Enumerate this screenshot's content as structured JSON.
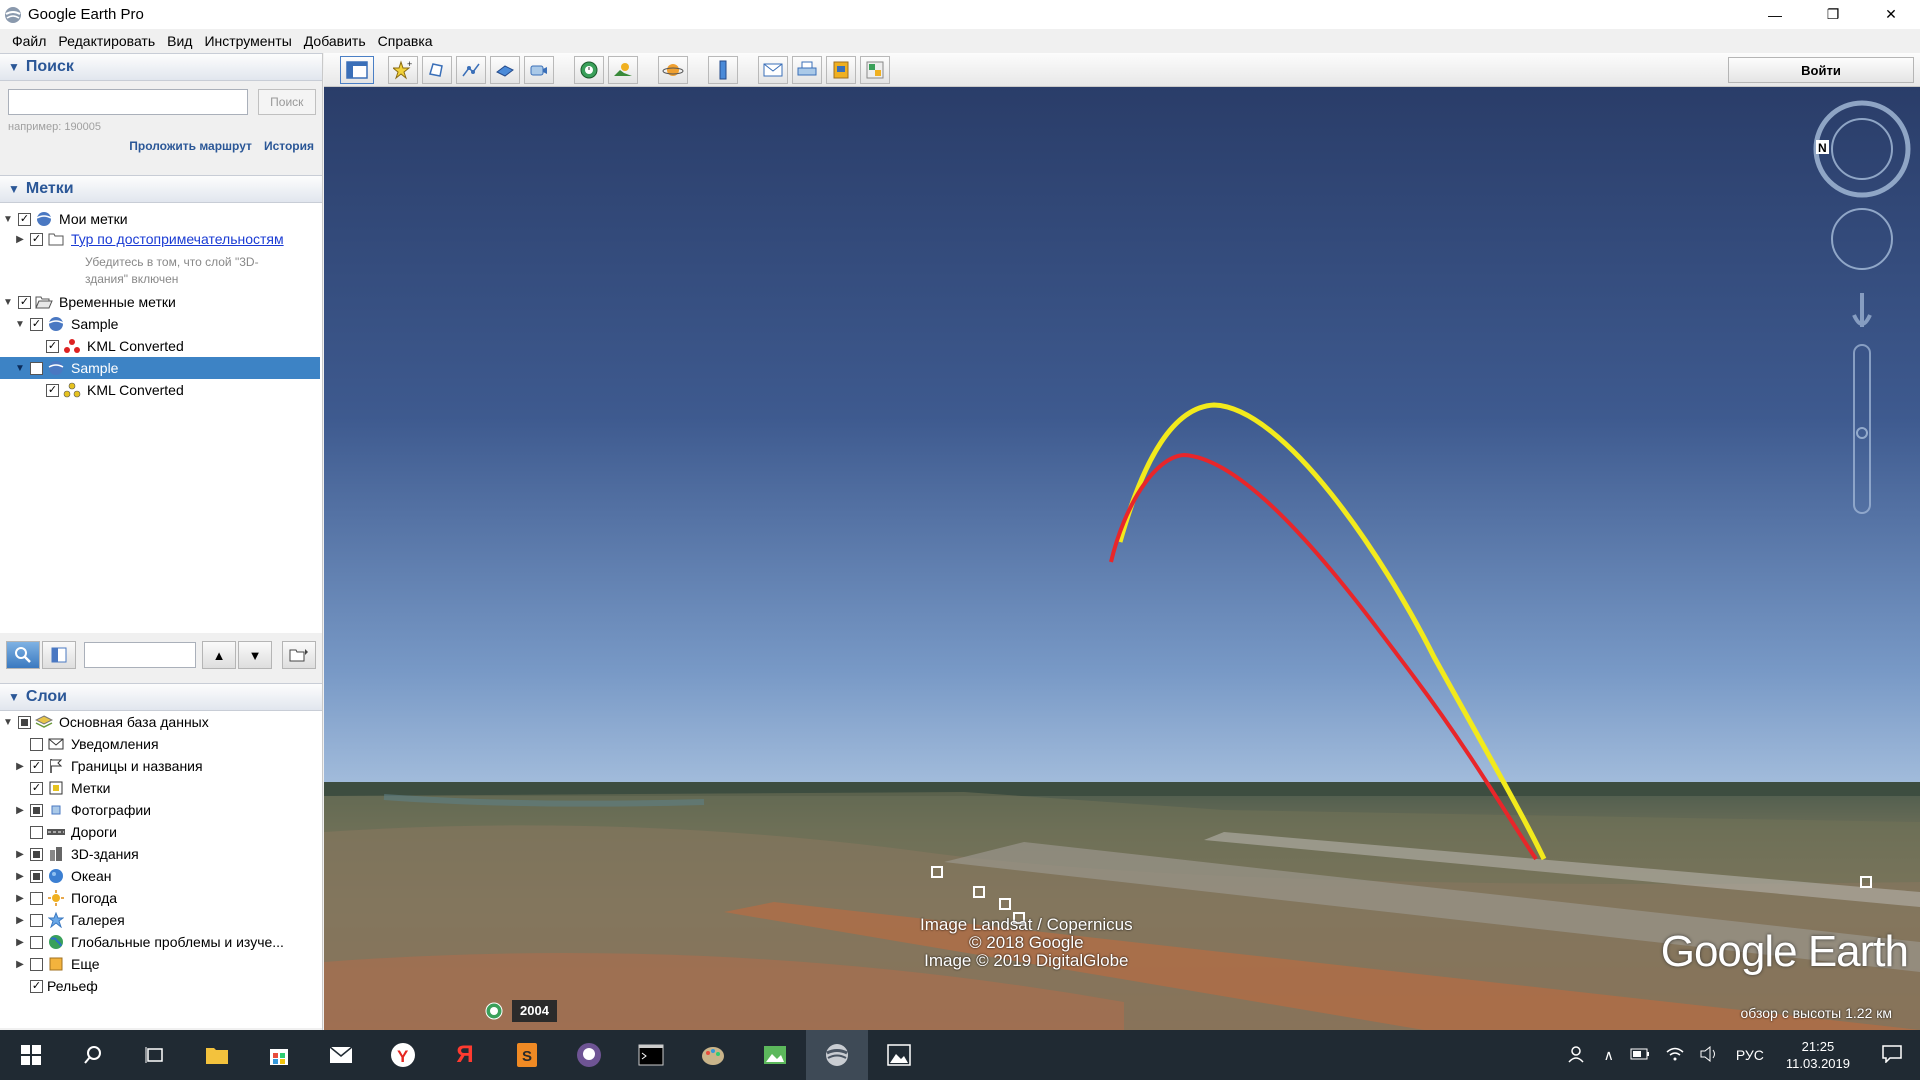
{
  "window": {
    "title": "Google Earth Pro",
    "minimize": "—",
    "maximize": "❐",
    "close": "✕"
  },
  "menu": [
    {
      "label": "Файл"
    },
    {
      "label": "Редактировать"
    },
    {
      "label": "Вид"
    },
    {
      "label": "Инструменты"
    },
    {
      "label": "Добавить"
    },
    {
      "label": "Справка"
    }
  ],
  "search": {
    "header": "Поиск",
    "input_value": "",
    "button": "Поиск",
    "hint": "например: 190005",
    "route_link": "Проложить маршрут",
    "history_link": "История"
  },
  "places": {
    "header": "Метки",
    "my_places": "Мои метки",
    "tour": "Тур по достопримечательностям",
    "tour_note_1": "Убедитесь в том, что слой \"3D-",
    "tour_note_2": "здания\" включен",
    "temp_places": "Временные метки",
    "sample1": "Sample",
    "kml1": "KML Converted",
    "sample2": "Sample",
    "kml2": "KML Converted"
  },
  "layers": {
    "header": "Слои",
    "items": [
      {
        "label": "Основная база данных"
      },
      {
        "label": "Уведомления"
      },
      {
        "label": "Границы и названия"
      },
      {
        "label": "Метки"
      },
      {
        "label": "Фотографии"
      },
      {
        "label": "Дороги"
      },
      {
        "label": "3D-здания"
      },
      {
        "label": "Океан"
      },
      {
        "label": "Погода"
      },
      {
        "label": "Галерея"
      },
      {
        "label": "Глобальные проблемы и изуче..."
      },
      {
        "label": "Еще"
      },
      {
        "label": "Рельеф"
      }
    ]
  },
  "toolbar": {
    "login": "Войти"
  },
  "map": {
    "attribution_1": "Image Landsat / Copernicus",
    "attribution_2": "© 2018 Google",
    "attribution_3": "Image © 2019 DigitalGlobe",
    "logo": "Google Earth",
    "altitude": "обзор с высоты   1.22 км",
    "year": "2004",
    "compass_label": "N",
    "track_colors": {
      "yellow": "#f2ea1c",
      "red": "#e8262a"
    }
  },
  "taskbar": {
    "language": "РУС",
    "time": "21:25",
    "date": "11.03.2019"
  }
}
